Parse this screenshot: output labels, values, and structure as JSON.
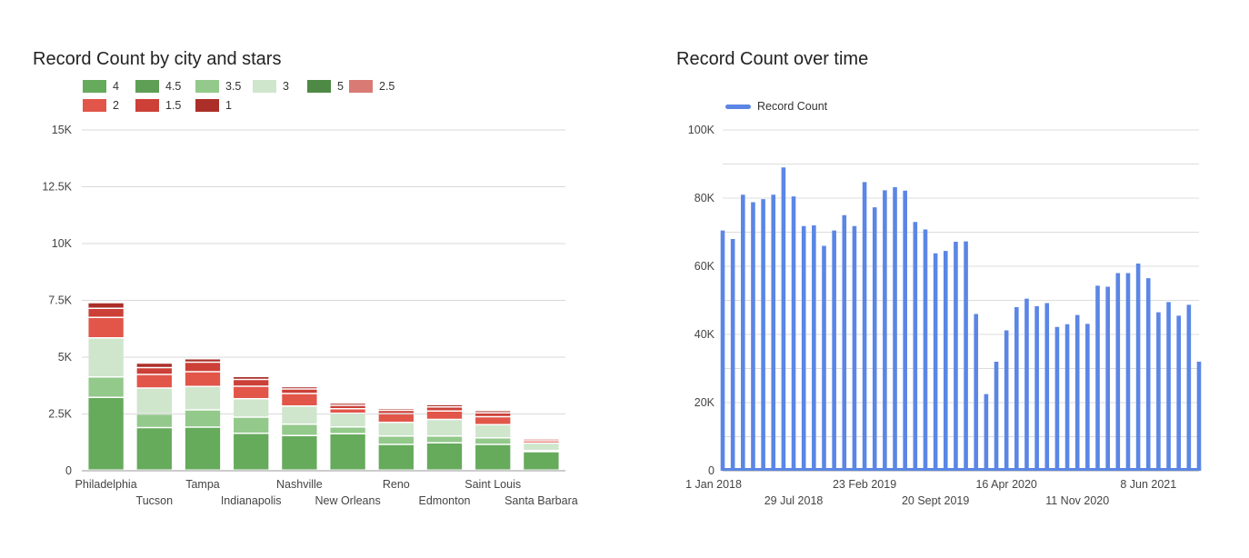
{
  "chart_data": [
    {
      "type": "bar",
      "stacked": true,
      "title": "Record Count by city and stars",
      "categories": [
        "Philadelphia",
        "Tucson",
        "Tampa",
        "Indianapolis",
        "Nashville",
        "New Orleans",
        "Reno",
        "Edmonton",
        "Saint Louis",
        "Santa Barbara"
      ],
      "ylim": [
        0,
        15000
      ],
      "yticks": [
        0,
        2500,
        5000,
        7500,
        10000,
        12500,
        15000
      ],
      "ytick_labels": [
        "0",
        "2.5K",
        "5K",
        "7.5K",
        "10K",
        "12.5K",
        "15K"
      ],
      "grid": true,
      "legend_position": "top-left",
      "series": [
        {
          "name": "4",
          "color": "#66aa5c",
          "values": [
            3200,
            1870,
            1890,
            1620,
            1520,
            1600,
            1130,
            1200,
            1130,
            810
          ]
        },
        {
          "name": "4.5",
          "color": "#5e9e55",
          "values": [
            0,
            0,
            0,
            0,
            0,
            0,
            0,
            0,
            0,
            0
          ]
        },
        {
          "name": "3.5",
          "color": "#93c98b",
          "values": [
            900,
            600,
            760,
            710,
            500,
            300,
            370,
            300,
            290,
            50
          ]
        },
        {
          "name": "3",
          "color": "#cfe6cd",
          "values": [
            1720,
            1140,
            1030,
            810,
            800,
            600,
            600,
            730,
            580,
            330
          ]
        },
        {
          "name": "5",
          "color": "#4e8a45",
          "values": [
            0,
            0,
            0,
            0,
            0,
            0,
            0,
            0,
            0,
            0
          ]
        },
        {
          "name": "2.5",
          "color": "#d97a74",
          "values": [
            0,
            0,
            0,
            0,
            0,
            0,
            0,
            0,
            0,
            0
          ]
        },
        {
          "name": "2",
          "color": "#e2564a",
          "values": [
            900,
            600,
            650,
            550,
            550,
            200,
            380,
            370,
            350,
            100
          ]
        },
        {
          "name": "1.5",
          "color": "#cc4038",
          "values": [
            400,
            300,
            420,
            300,
            200,
            150,
            150,
            180,
            170,
            80
          ]
        },
        {
          "name": "1",
          "color": "#ab2f28",
          "values": [
            250,
            200,
            150,
            130,
            100,
            100,
            80,
            100,
            100,
            50
          ]
        }
      ]
    },
    {
      "type": "bar",
      "title": "Record Count over time",
      "ylim": [
        0,
        100000
      ],
      "yticks": [
        0,
        20000,
        40000,
        60000,
        80000,
        100000
      ],
      "ytick_labels": [
        "0",
        "20K",
        "40K",
        "60K",
        "80K",
        "100K"
      ],
      "grid": true,
      "legend_position": "top-left",
      "series": [
        {
          "name": "Record Count",
          "color": "#5b86e5",
          "values": [
            70500,
            68000,
            81000,
            78800,
            79700,
            81000,
            89000,
            80500,
            71800,
            72000,
            66000,
            70500,
            75000,
            71800,
            84700,
            77300,
            82300,
            83200,
            82200,
            73000,
            70800,
            63800,
            64500,
            67200,
            67300,
            46000,
            22500,
            32000,
            41200,
            48000,
            50500,
            48300,
            49200,
            42200,
            43000,
            45700,
            43100,
            54300,
            54000,
            58000,
            58000,
            60800,
            56500,
            46500,
            49500,
            45500,
            48700,
            32000
          ]
        }
      ],
      "x_tick_labels": [
        "1 Jan 2018",
        "29 Jul 2018",
        "23 Feb 2019",
        "20 Sept 2019",
        "16 Apr 2020",
        "11 Nov 2020",
        "8 Jun 2021"
      ]
    }
  ]
}
